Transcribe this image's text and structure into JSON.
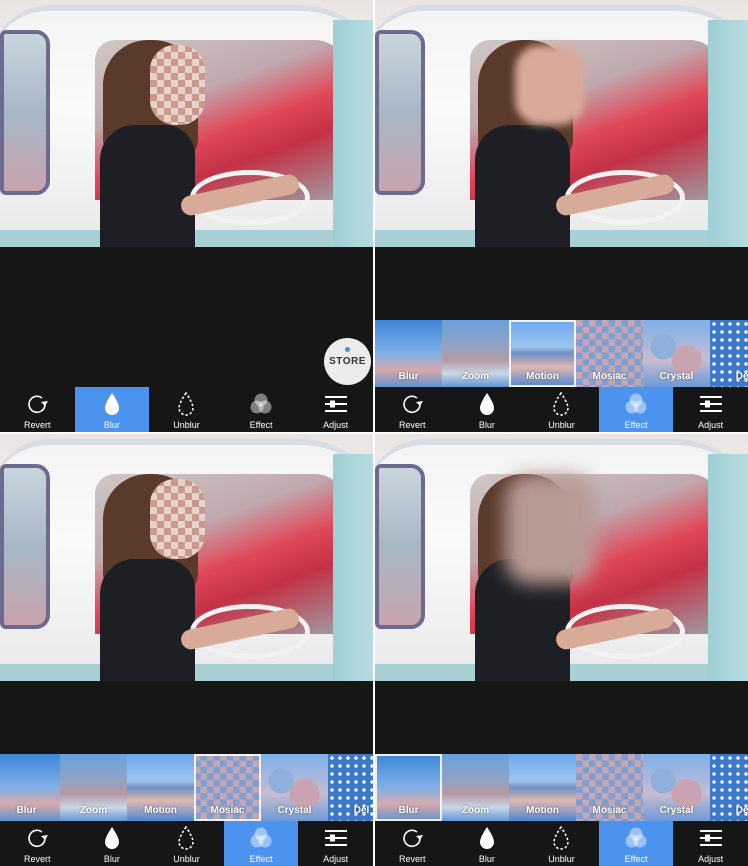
{
  "toolbar": {
    "tools": [
      {
        "label": "Revert",
        "icon": "revert-icon"
      },
      {
        "label": "Blur",
        "icon": "drop-icon"
      },
      {
        "label": "Unblur",
        "icon": "dashed-drop-icon"
      },
      {
        "label": "Effect",
        "icon": "effect-circles-icon"
      },
      {
        "label": "Adjust",
        "icon": "sliders-icon"
      }
    ]
  },
  "effects": [
    "Blur",
    "Zoom",
    "Motion",
    "Mosiac",
    "Crystal",
    "Del"
  ],
  "store_label": "STORE",
  "accent_color": "#4c93f0",
  "panels": [
    {
      "active_tool": "Blur",
      "show_store": true,
      "show_effects": false,
      "selected_effect": null,
      "face_effect": "mosaic"
    },
    {
      "active_tool": "Effect",
      "show_store": false,
      "show_effects": true,
      "selected_effect": "Motion",
      "face_effect": "motion"
    },
    {
      "active_tool": "Effect",
      "show_store": false,
      "show_effects": true,
      "selected_effect": "Mosiac",
      "face_effect": "mosaic"
    },
    {
      "active_tool": "Effect",
      "show_store": false,
      "show_effects": true,
      "selected_effect": "Blur",
      "face_effect": "gblur"
    }
  ]
}
